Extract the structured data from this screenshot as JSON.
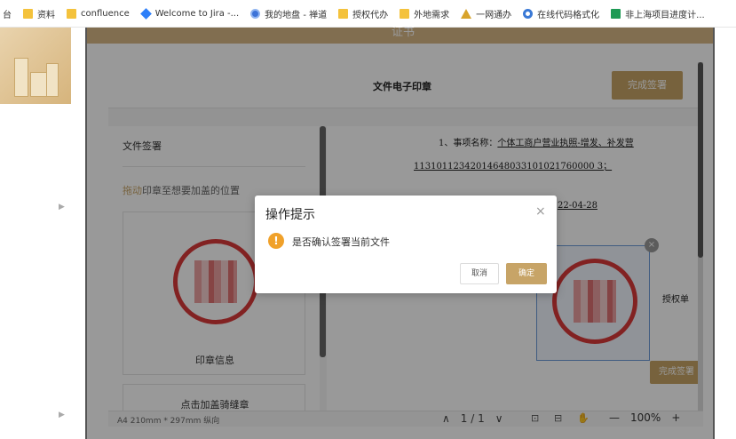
{
  "bookmarks": [
    {
      "label": "台",
      "icon": "none"
    },
    {
      "label": "资料",
      "icon": "folder-icon"
    },
    {
      "label": "confluence",
      "icon": "folder-icon"
    },
    {
      "label": "Welcome to Jira -...",
      "icon": "jira-icon"
    },
    {
      "label": "我的地盘 - 禅道",
      "icon": "globe-icon"
    },
    {
      "label": "授权代办",
      "icon": "folder-icon"
    },
    {
      "label": "外地需求",
      "icon": "folder-icon"
    },
    {
      "label": "一网通办",
      "icon": "mountain-icon"
    },
    {
      "label": "在线代码格式化",
      "icon": "c-logo-icon"
    },
    {
      "label": "非上海项目进度计...",
      "icon": "spreadsheet-icon"
    }
  ],
  "page": {
    "header_title": "证书"
  },
  "seal_dialog": {
    "title": "文件电子印章",
    "finish_button": "完成签署",
    "left_panel": {
      "section_title": "文件签署",
      "hint_drag": "拖动",
      "hint_rest": "印章至想要加盖的位置",
      "seal_info_label": "印章信息",
      "add_seal_label": "点击加盖骑缝章"
    },
    "document": {
      "line1_prefix": "1、事项名称：",
      "line1_value": "个体工商户营业执照-增发、补发营",
      "line2": "11310112342014648033101021760000 3；",
      "line3": "22-04-28",
      "line4": "授权单"
    },
    "placed_seal_finish_button": "完成签署",
    "footer": {
      "page_size": "A4 210mm * 297mm 纵向",
      "prev": "∧",
      "page_indicator": "1 / 1",
      "next": "∨",
      "zoom_out": "—",
      "zoom_level": "100%",
      "zoom_in": "+"
    }
  },
  "confirm_dialog": {
    "title": "操作提示",
    "message": "是否确认签署当前文件",
    "cancel_button": "取消",
    "ok_button": "确定",
    "close": "×",
    "warn_glyph": "!"
  },
  "colors": {
    "accent_gold": "#c7a467",
    "warning_orange": "#f0a12a",
    "stamp_red": "#d93a3a"
  }
}
